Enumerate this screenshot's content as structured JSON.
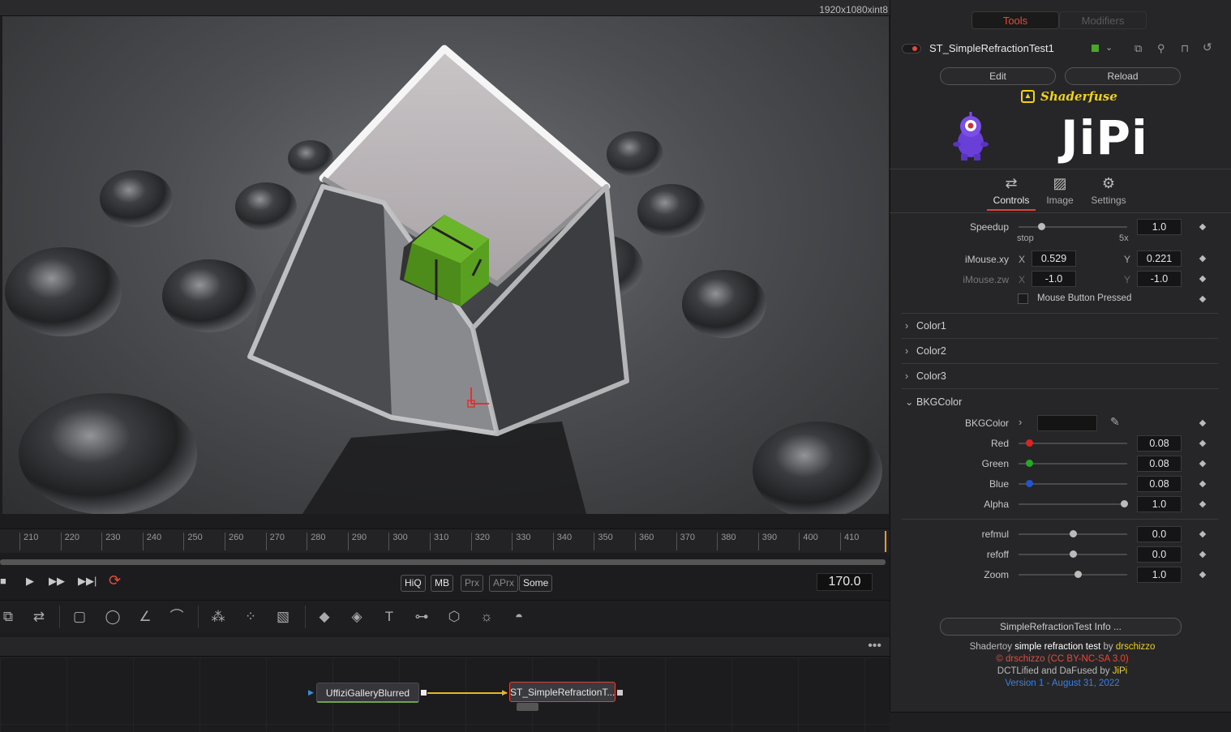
{
  "viewer": {
    "resolution": "1920x1080xint8"
  },
  "timeline": {
    "ticks": [
      "210",
      "220",
      "230",
      "240",
      "250",
      "260",
      "270",
      "280",
      "290",
      "300",
      "310",
      "320",
      "330",
      "340",
      "350",
      "360",
      "370",
      "380",
      "390",
      "400",
      "410"
    ]
  },
  "transport": {
    "quality_buttons": [
      "HiQ",
      "MB",
      "Prx",
      "APrx",
      "Some"
    ],
    "current_frame": "170.0"
  },
  "nodes": {
    "source": "UffiziGalleryBlurred",
    "shader": "ST_SimpleRefractionT..."
  },
  "inspector": {
    "tabs": {
      "tools": "Tools",
      "modifiers": "Modifiers"
    },
    "tool_name": "ST_SimpleRefractionTest1",
    "edit_label": "Edit",
    "reload_label": "Reload",
    "brand": "Shaderfuse",
    "author_logo": "JiPi",
    "subtabs": {
      "controls": "Controls",
      "image": "Image",
      "settings": "Settings"
    },
    "speedup": {
      "label": "Speedup",
      "value": "1.0",
      "min_label": "stop",
      "max_label": "5x",
      "position": 0.05
    },
    "imouse_xy": {
      "label": "iMouse.xy",
      "x_label": "X",
      "x": "0.529",
      "y_label": "Y",
      "y": "0.221"
    },
    "imouse_zw": {
      "label": "iMouse.zw",
      "x_label": "X",
      "x": "-1.0",
      "y_label": "Y",
      "y": "-1.0"
    },
    "mouse_pressed": "Mouse Button Pressed",
    "sections": {
      "color1": "Color1",
      "color2": "Color2",
      "color3": "Color3",
      "bkgcolor": "BKGColor"
    },
    "bkg": {
      "label": "BKGColor",
      "red": {
        "label": "Red",
        "value": "0.08",
        "color": "#d22",
        "position": 0.08
      },
      "green": {
        "label": "Green",
        "value": "0.08",
        "color": "#2a2",
        "position": 0.08
      },
      "blue": {
        "label": "Blue",
        "value": "0.08",
        "color": "#25c",
        "position": 0.08
      },
      "alpha": {
        "label": "Alpha",
        "value": "1.0",
        "color": "#bbb",
        "position": 1.0
      }
    },
    "refmul": {
      "label": "refmul",
      "value": "0.0"
    },
    "refoff": {
      "label": "refoff",
      "value": "0.0"
    },
    "zoom": {
      "label": "Zoom",
      "value": "1.0"
    },
    "info_button": "SimpleRefractionTest Info ...",
    "credits": {
      "l1a": "Shadertoy ",
      "l1b": "simple refraction test",
      "l1c": " by ",
      "l1d": "drschizzo",
      "l2": "© drschizzo (CC BY-NC-SA 3.0)",
      "l3a": "DCTLified and DaFused by ",
      "l3b": "JiPi",
      "l4": "Version 1 - August 31, 2022"
    }
  }
}
